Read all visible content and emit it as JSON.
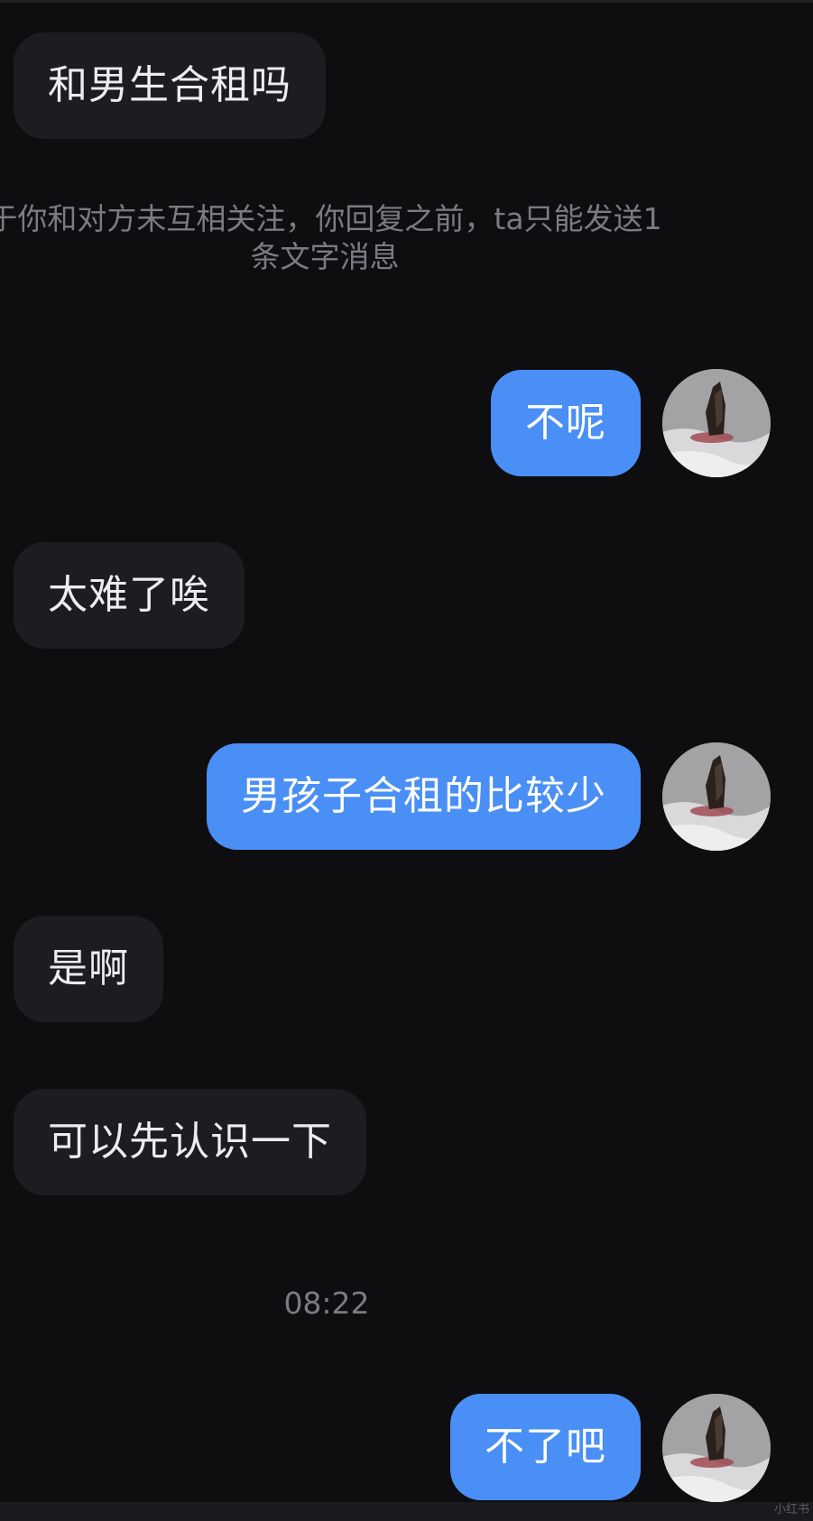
{
  "messages": [
    {
      "side": "in",
      "text": "和男生合租吗"
    },
    {
      "side": "out",
      "text": "不呢"
    },
    {
      "side": "in",
      "text": "太难了唉"
    },
    {
      "side": "out",
      "text": "男孩子合租的比较少"
    },
    {
      "side": "in",
      "text": "是啊"
    },
    {
      "side": "in",
      "text": "可以先认识一下"
    },
    {
      "side": "out",
      "text": "不了吧"
    }
  ],
  "system_notice": {
    "line1": "于你和对方未互相关注，你回复之前，ta只能发送1",
    "line2": "条文字消息"
  },
  "timestamp": "08:22",
  "colors": {
    "background": "#0e0e11",
    "incoming_bubble": "#1c1c21",
    "outgoing_bubble": "#4a8ff5",
    "system_text": "#7b7b84"
  },
  "avatar_icon": "moth-photo-avatar",
  "watermark": "小红书"
}
